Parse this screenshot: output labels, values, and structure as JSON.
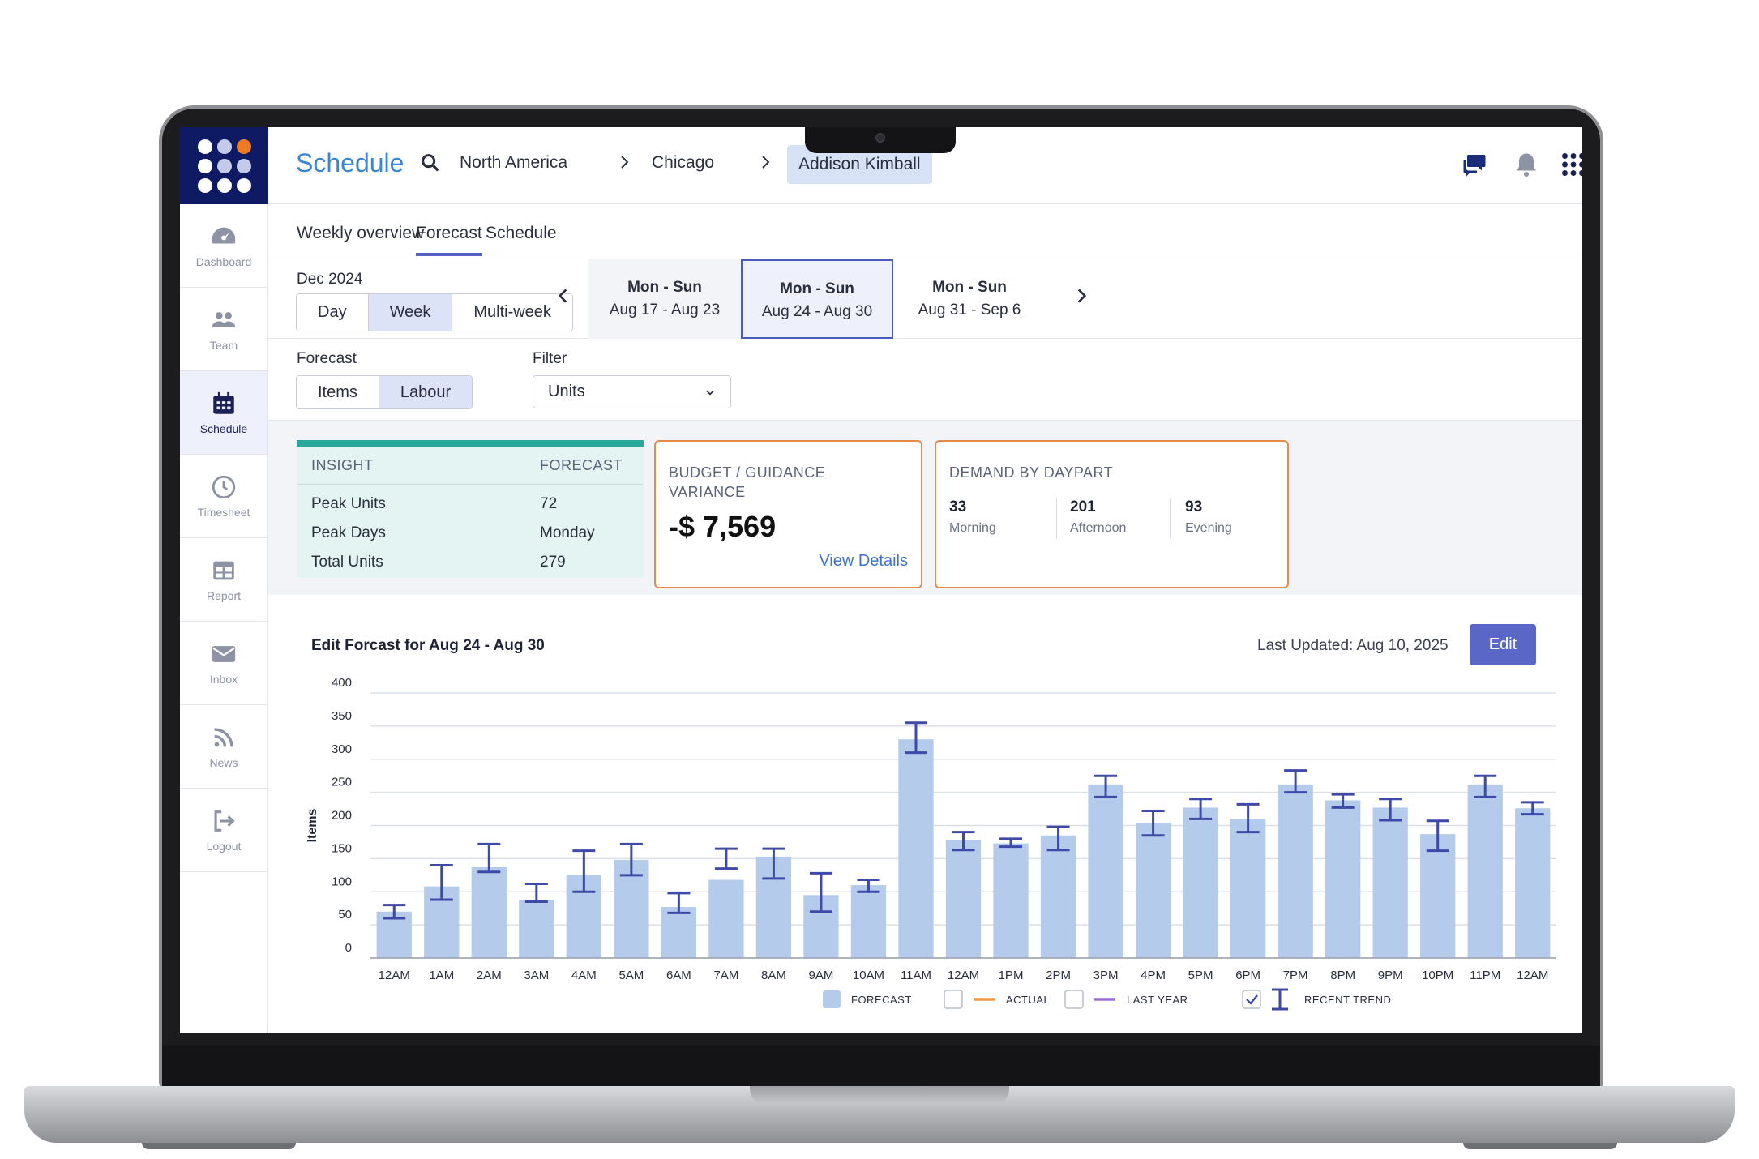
{
  "app": {
    "title": "Schedule"
  },
  "breadcrumb": {
    "items": [
      "North America",
      "Chicago"
    ],
    "active": "Addison Kimball"
  },
  "sidebar": {
    "items": [
      {
        "label": "Dashboard",
        "icon": "dashboard-icon"
      },
      {
        "label": "Team",
        "icon": "team-icon"
      },
      {
        "label": "Schedule",
        "icon": "calendar-icon",
        "active": true
      },
      {
        "label": "Timesheet",
        "icon": "clock-icon"
      },
      {
        "label": "Report",
        "icon": "report-icon"
      },
      {
        "label": "Inbox",
        "icon": "mail-icon"
      },
      {
        "label": "News",
        "icon": "rss-icon"
      },
      {
        "label": "Logout",
        "icon": "logout-icon"
      }
    ]
  },
  "tabs": [
    "Weekly overview",
    "Forecast",
    "Schedule"
  ],
  "active_tab": "Forecast",
  "period": {
    "month": "Dec 2024",
    "views": [
      "Day",
      "Week",
      "Multi-week"
    ],
    "selected_view": "Week",
    "weeks": [
      {
        "days": "Mon - Sun",
        "range": "Aug 17 - Aug 23"
      },
      {
        "days": "Mon - Sun",
        "range": "Aug 24 - Aug 30",
        "selected": true
      },
      {
        "days": "Mon - Sun",
        "range": "Aug 31 - Sep 6"
      }
    ]
  },
  "filters": {
    "forecast_label": "Forecast",
    "forecast_options": [
      "Items",
      "Labour"
    ],
    "forecast_selected": "Labour",
    "filter_label": "Filter",
    "filter_value": "Units"
  },
  "insight": {
    "head_left": "INSIGHT",
    "head_right": "FORECAST",
    "rows": [
      {
        "label": "Peak Units",
        "value": "72"
      },
      {
        "label": "Peak Days",
        "value": "Monday"
      },
      {
        "label": "Total Units",
        "value": "279"
      }
    ]
  },
  "budget": {
    "title_line1": "BUDGET / GUIDANCE",
    "title_line2": "VARIANCE",
    "value": "-$ 7,569",
    "link": "View Details"
  },
  "demand": {
    "title": "DEMAND BY DAYPART",
    "parts": [
      {
        "value": "33",
        "label": "Morning"
      },
      {
        "value": "201",
        "label": "Afternoon"
      },
      {
        "value": "93",
        "label": "Evening"
      }
    ]
  },
  "chart_header": {
    "title": "Edit Forcast  for Aug 24 - Aug 30",
    "updated": "Last Updated: Aug 10, 2025",
    "edit_label": "Edit"
  },
  "colors": {
    "forecast": "#b4cbec",
    "actual": "#f0963e",
    "last_year": "#9a6fd6",
    "trend": "#3f4aa8",
    "accent": "#5b67c7"
  },
  "chart_data": {
    "type": "bar",
    "ylabel": "Items",
    "ylim": [
      0,
      400
    ],
    "yticks": [
      0,
      50,
      100,
      150,
      200,
      250,
      300,
      350,
      400
    ],
    "categories": [
      "12AM",
      "1AM",
      "2AM",
      "3AM",
      "4AM",
      "5AM",
      "6AM",
      "7AM",
      "8AM",
      "9AM",
      "10AM",
      "11AM",
      "12AM",
      "1PM",
      "2PM",
      "3PM",
      "4PM",
      "5PM",
      "6PM",
      "7PM",
      "8PM",
      "9PM",
      "10PM",
      "11PM",
      "12AM"
    ],
    "series": [
      {
        "name": "FORECAST",
        "values": [
          70,
          108,
          137,
          88,
          125,
          148,
          77,
          118,
          153,
          95,
          110,
          330,
          178,
          173,
          185,
          262,
          203,
          227,
          210,
          262,
          238,
          227,
          187,
          262,
          226
        ]
      }
    ],
    "trend_ranges": [
      [
        60,
        80
      ],
      [
        88,
        140
      ],
      [
        130,
        172
      ],
      [
        85,
        112
      ],
      [
        100,
        162
      ],
      [
        125,
        172
      ],
      [
        68,
        98
      ],
      [
        135,
        165
      ],
      [
        120,
        165
      ],
      [
        70,
        128
      ],
      [
        100,
        118
      ],
      [
        310,
        355
      ],
      [
        163,
        190
      ],
      [
        168,
        180
      ],
      [
        163,
        198
      ],
      [
        243,
        275
      ],
      [
        185,
        222
      ],
      [
        210,
        240
      ],
      [
        190,
        232
      ],
      [
        250,
        283
      ],
      [
        227,
        247
      ],
      [
        208,
        240
      ],
      [
        162,
        207
      ],
      [
        243,
        275
      ],
      [
        217,
        235
      ]
    ],
    "legend": [
      {
        "label": "FORECAST",
        "checked": true
      },
      {
        "label": "ACTUAL",
        "checked": false
      },
      {
        "label": "LAST YEAR",
        "checked": false
      },
      {
        "label": "RECENT TREND",
        "checked": true
      }
    ]
  }
}
